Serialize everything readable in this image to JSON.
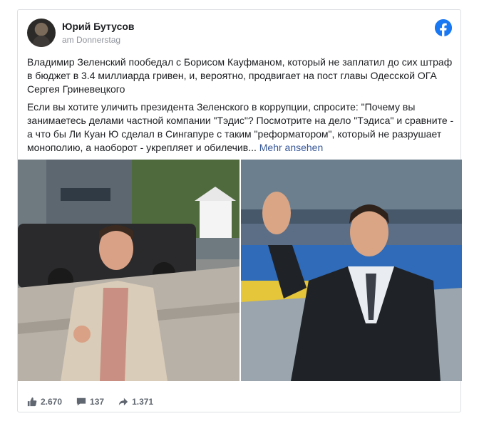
{
  "post": {
    "author": "Юрий Бутусов",
    "timestamp": "am Donnerstag",
    "paragraph1": "Владимир Зеленский пообедал с Борисом Кауфманом, который не заплатил до сих штраф в бюджет в 3.4 миллиарда гривен, и, вероятно, продвигает на пост главы Одесской ОГА Сергея Гриневецкого",
    "paragraph2": "Если вы хотите уличить президента Зеленского в коррупции, спросите: \"Почему вы занимаетесь делами частной компании \"Тэдис\"? Посмотрите на дело \"Тэдиса\" и сравните - а что бы Ли Куан Ю сделал в Сингапуре с таким \"реформатором\", который не разрушает монополию, а наоборот - укрепляет и обилечив...",
    "see_more": "Mehr ansehen"
  },
  "stats": {
    "likes": "2.670",
    "comments": "137",
    "shares": "1.371"
  },
  "icons": {
    "brand": "facebook-icon",
    "like": "thumbs-up-icon",
    "comment": "speech-bubble-icon",
    "share": "share-arrow-icon"
  },
  "colors": {
    "brand": "#1877f2",
    "link": "#385898",
    "meta": "#606770"
  }
}
